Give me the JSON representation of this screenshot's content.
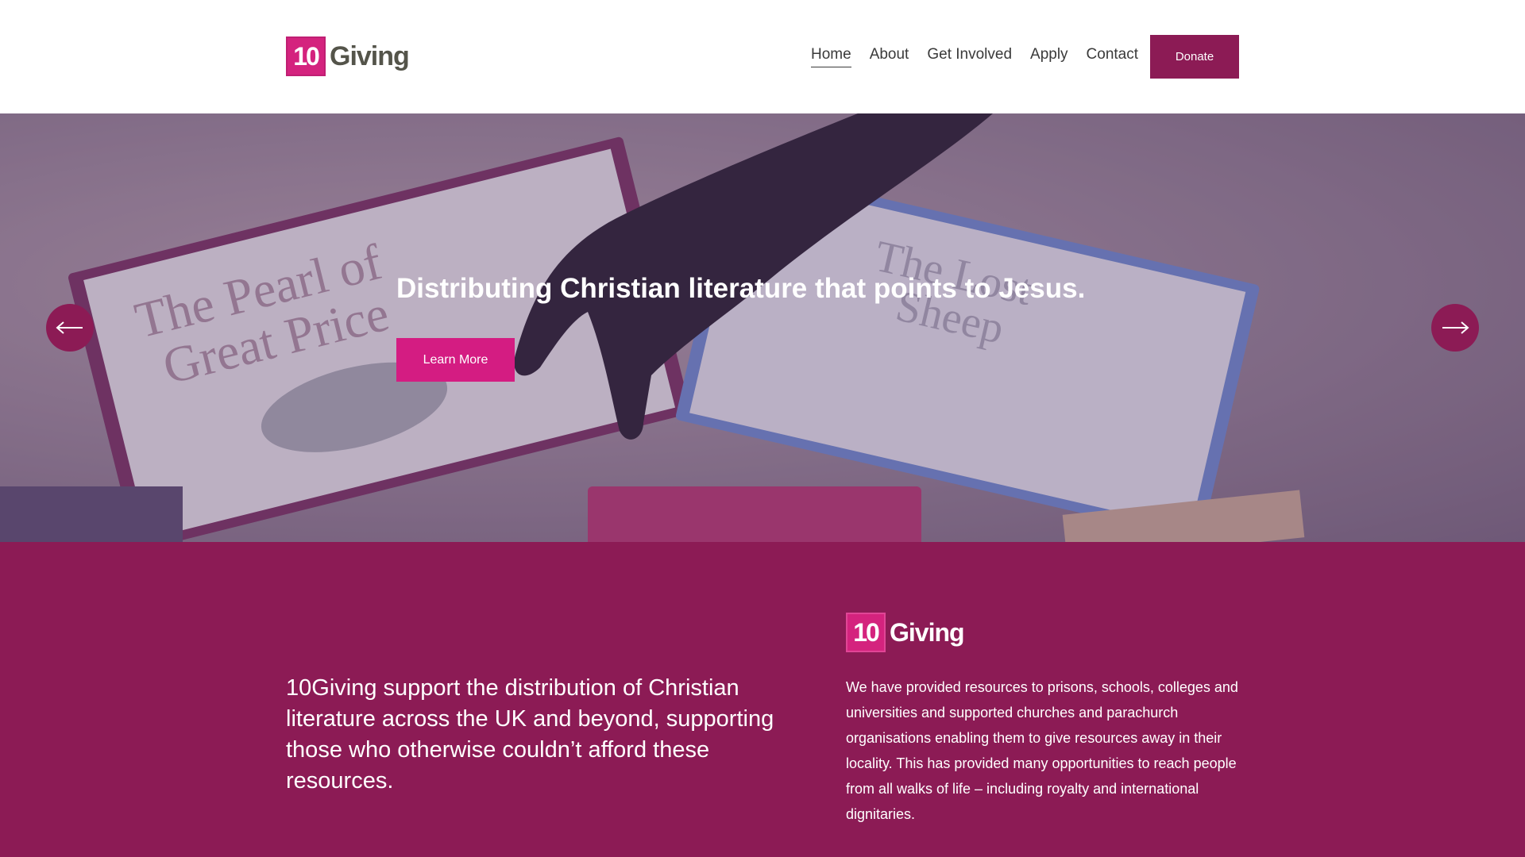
{
  "brand": {
    "logo_number": "10",
    "logo_word": "Giving"
  },
  "nav": {
    "items": [
      {
        "label": "Home",
        "active": true
      },
      {
        "label": "About"
      },
      {
        "label": "Get Involved"
      },
      {
        "label": "Apply"
      },
      {
        "label": "Contact"
      }
    ],
    "donate_label": "Donate"
  },
  "hero": {
    "title": "Distributing Christian literature that points to Jesus.",
    "button_label": "Learn More",
    "prev_icon": "arrow-left-icon",
    "next_icon": "arrow-right-icon"
  },
  "intro": {
    "text": "10Giving support the distribution of Christian literature across the UK and beyond, supporting those who otherwise couldn’t afford these resources."
  },
  "about": {
    "text": "We have provided resources to prisons, schools, colleges and universities and supported churches and parachurch organisations enabling them to give resources away in their locality. This has provided many opportunities to reach people from all walks of life – including royalty and international dignitaries."
  },
  "colors": {
    "brand_primary": "#8c1b55",
    "brand_accent": "#d41c82",
    "header_bg": "#ffffff"
  }
}
